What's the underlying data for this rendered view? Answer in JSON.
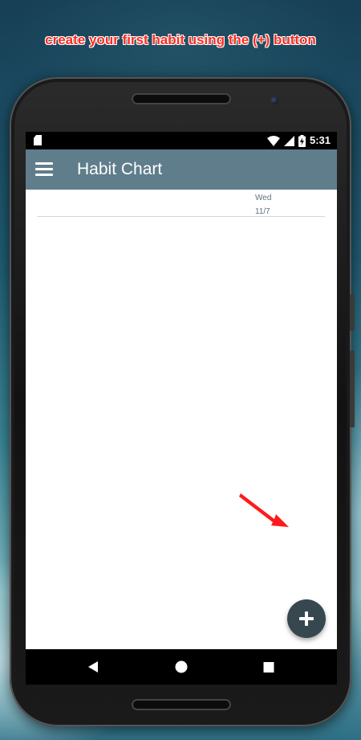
{
  "banner": {
    "text": "create your first habit using the (+) button"
  },
  "status_bar": {
    "time": "5:31",
    "icons": [
      "sd-card-icon",
      "wifi-icon",
      "signal-icon",
      "battery-charging-icon"
    ]
  },
  "app_bar": {
    "title": "Habit Chart",
    "menu_icon": "hamburger-menu-icon"
  },
  "chart": {
    "columns": [
      {
        "day": "Wed",
        "date": "11/7"
      }
    ]
  },
  "fab": {
    "icon": "plus-icon"
  },
  "nav_bar": {
    "buttons": [
      "back-icon",
      "home-icon",
      "recents-icon"
    ]
  },
  "colors": {
    "app_bar": "#607d8b",
    "fab": "#37474f",
    "banner_text": "#ff2a1f",
    "arrow": "#ff1a1a",
    "header_text": "#5f7380"
  }
}
